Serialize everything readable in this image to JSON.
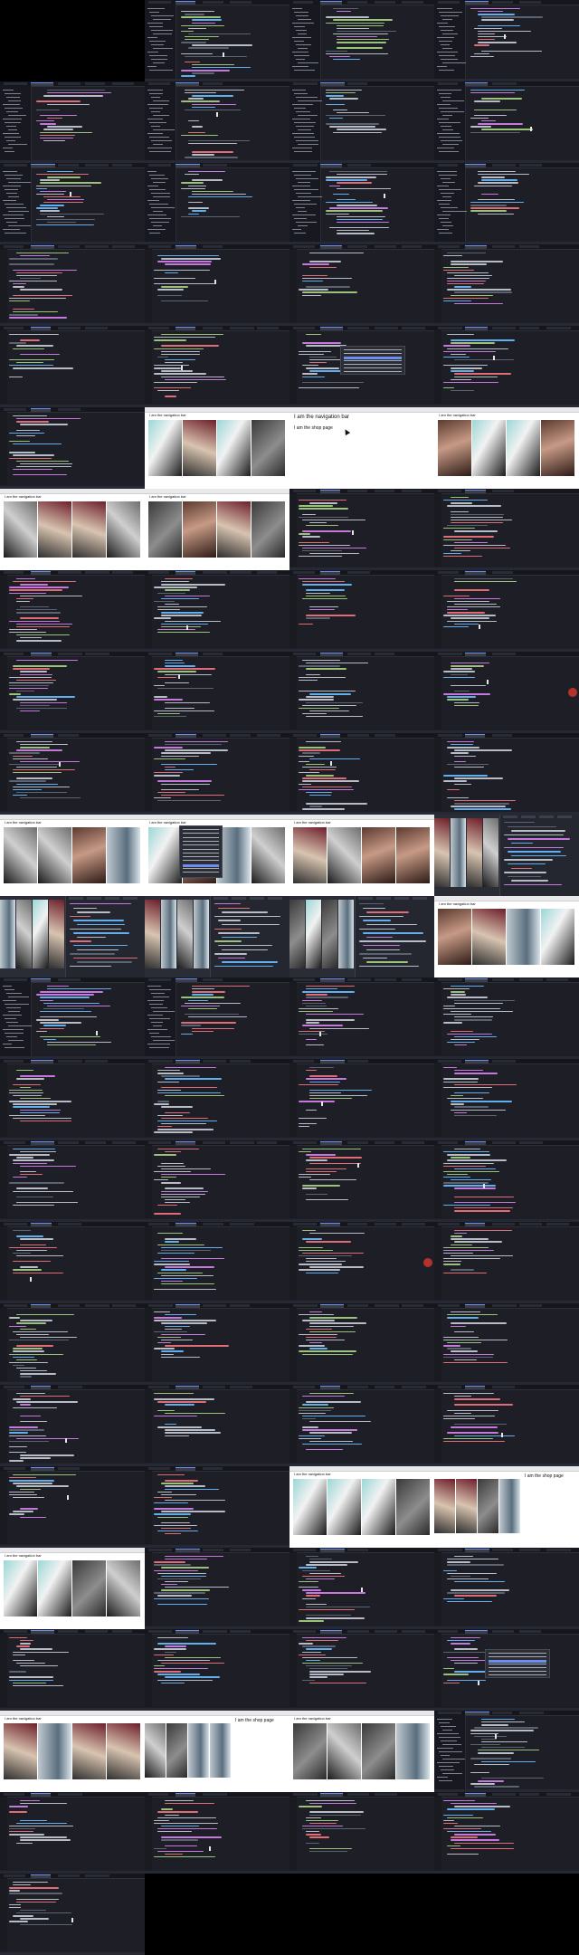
{
  "page": {
    "description_free": true
  },
  "captions": {
    "navigation_bar": "I am the navigation bar",
    "shop_page": "I am the shop page"
  },
  "colors": {
    "editor_bg": "#1e1f26",
    "keyword": "#c678dd",
    "function": "#61afef",
    "string": "#98c379",
    "tag": "#e06c75",
    "accent": "#6b8ef0"
  },
  "icons": {
    "pointer": "mouse-pointer-icon",
    "record": "record-dot-icon"
  }
}
